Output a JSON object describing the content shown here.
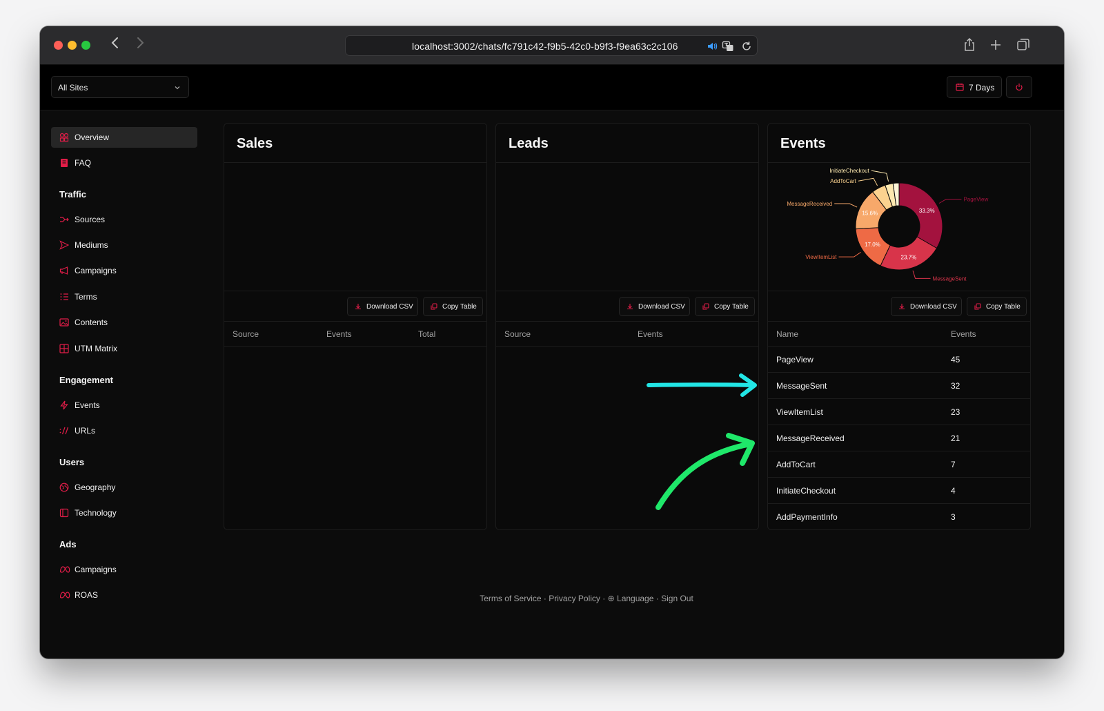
{
  "browser": {
    "url": "localhost:3002/chats/fc791c42-f9b5-42c0-b9f3-f9ea63c2c106"
  },
  "header": {
    "site_select": "All Sites",
    "date_range": "7 Days"
  },
  "sidebar": {
    "top_items": [
      {
        "label": "Overview",
        "icon": "overview-icon",
        "active": true
      },
      {
        "label": "FAQ",
        "icon": "faq-icon"
      }
    ],
    "traffic": {
      "title": "Traffic",
      "items": [
        {
          "label": "Sources",
          "icon": "sources-icon"
        },
        {
          "label": "Mediums",
          "icon": "mediums-icon"
        },
        {
          "label": "Campaigns",
          "icon": "megaphone-icon"
        },
        {
          "label": "Terms",
          "icon": "terms-icon"
        },
        {
          "label": "Contents",
          "icon": "image-icon"
        },
        {
          "label": "UTM Matrix",
          "icon": "grid-icon"
        }
      ]
    },
    "engagement": {
      "title": "Engagement",
      "items": [
        {
          "label": "Events",
          "icon": "lightning-icon"
        },
        {
          "label": "URLs",
          "icon": "url-icon"
        }
      ]
    },
    "users": {
      "title": "Users",
      "items": [
        {
          "label": "Geography",
          "icon": "globe-icon"
        },
        {
          "label": "Technology",
          "icon": "device-icon"
        }
      ]
    },
    "ads": {
      "title": "Ads",
      "items": [
        {
          "label": "Campaigns",
          "icon": "meta-icon"
        },
        {
          "label": "ROAS",
          "icon": "meta-icon"
        }
      ]
    }
  },
  "cards": {
    "sales": {
      "title": "Sales",
      "download": "Download CSV",
      "copy": "Copy Table",
      "columns": [
        "Source",
        "Events",
        "Total"
      ]
    },
    "leads": {
      "title": "Leads",
      "download": "Download CSV",
      "copy": "Copy Table",
      "columns": [
        "Source",
        "Events"
      ]
    },
    "events": {
      "title": "Events",
      "download": "Download CSV",
      "copy": "Copy Table",
      "columns": [
        "Name",
        "Events"
      ],
      "rows": [
        {
          "name": "PageView",
          "value": "45"
        },
        {
          "name": "MessageSent",
          "value": "32"
        },
        {
          "name": "ViewItemList",
          "value": "23"
        },
        {
          "name": "MessageReceived",
          "value": "21"
        },
        {
          "name": "AddToCart",
          "value": "7"
        },
        {
          "name": "InitiateCheckout",
          "value": "4"
        },
        {
          "name": "AddPaymentInfo",
          "value": "3"
        }
      ]
    }
  },
  "chart_data": {
    "type": "pie",
    "categories": [
      "PageView",
      "MessageSent",
      "ViewItemList",
      "MessageReceived",
      "AddToCart",
      "InitiateCheckout",
      "AddPaymentInfo"
    ],
    "values": [
      45,
      32,
      23,
      21,
      7,
      4,
      3
    ],
    "percent_labels": [
      "33.3%",
      "23.7%",
      "17.0%",
      "15.6%",
      "",
      "",
      ""
    ],
    "colors": [
      "#a3123e",
      "#d8344a",
      "#ee6a45",
      "#f7a86a",
      "#fbd28f",
      "#fde9b0",
      "#fff6d8"
    ],
    "title": ""
  },
  "footer": {
    "terms": "Terms of Service",
    "privacy": "Privacy Policy",
    "language": "Language",
    "signout": "Sign Out"
  },
  "colors": {
    "accent": "#e11d48",
    "annotation_cyan": "#22e6e6",
    "annotation_green": "#1fe86a"
  }
}
